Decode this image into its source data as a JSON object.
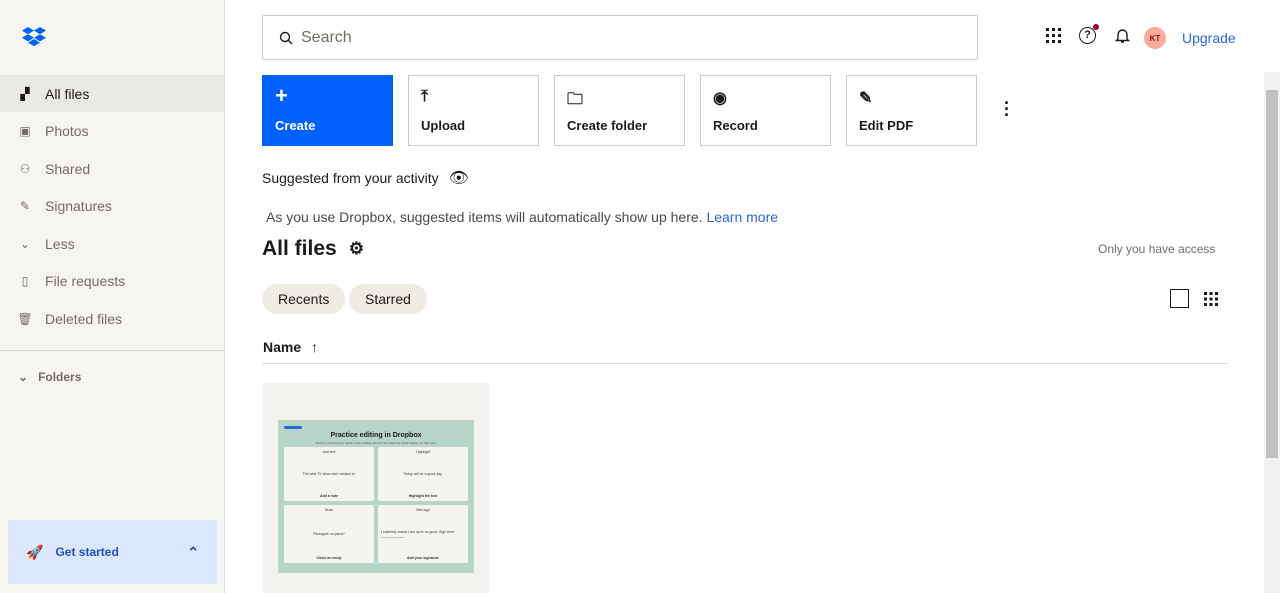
{
  "sidebar": {
    "items": [
      {
        "label": "All files",
        "icon": "all-files-icon"
      },
      {
        "label": "Photos",
        "icon": "photo-icon"
      },
      {
        "label": "Shared",
        "icon": "shared-icon"
      },
      {
        "label": "Signatures",
        "icon": "signature-icon"
      },
      {
        "label": "Less",
        "icon": "chevron-down-icon"
      },
      {
        "label": "File requests",
        "icon": "file-request-icon"
      },
      {
        "label": "Deleted files",
        "icon": "trash-icon"
      }
    ],
    "folders_label": "Folders",
    "get_started": "Get started"
  },
  "header": {
    "search_placeholder": "Search",
    "avatar_initials": "KT",
    "upgrade": "Upgrade"
  },
  "actions": {
    "create": "Create",
    "upload": "Upload",
    "create_folder": "Create folder",
    "record": "Record",
    "edit_pdf": "Edit PDF"
  },
  "suggested": {
    "title": "Suggested from your activity",
    "message": "As you use Dropbox, suggested items will automatically show up here.",
    "learn_more": "Learn more"
  },
  "main": {
    "title": "All files",
    "access": "Only you have access",
    "chips": [
      "Recents",
      "Starred"
    ],
    "column_name": "Name"
  },
  "file_preview": {
    "title": "Practice editing in Dropbox",
    "subtitle": "Start by choosing any option in the toolbar above! Then take the action below. It's that easy.",
    "cells": [
      {
        "tag": "Add text",
        "text": "The best TV show ever created is:",
        "footer": "Add a note"
      },
      {
        "tag": "Highlight",
        "text": "Today will be a good day.",
        "footer": "Highlight the text"
      },
      {
        "tag": "Draw",
        "text": "Pineapple on pizza?",
        "footer": "Circle an emoji"
      },
      {
        "tag": "Self-sign",
        "text": "I solemnly swear I am up to no good. Sign here: ____________",
        "footer": "Add your signature"
      }
    ]
  },
  "colors": {
    "accent": "#0061fe",
    "link": "#2766e5",
    "sidebar_bg": "#f7f5f2",
    "get_started_bg": "#dbe8ff",
    "avatar": "#fbaa9c",
    "preview_bg": "#b7d5c8"
  }
}
